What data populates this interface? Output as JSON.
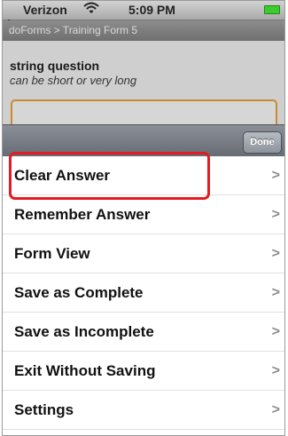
{
  "status": {
    "carrier": "Verizon",
    "wifi_icon": "wifi-icon",
    "time": "5:09 PM",
    "battery_icon": "battery-icon",
    "battery_color": "#3ccb2f"
  },
  "app": {
    "breadcrumb": "doForms > Training Form 5"
  },
  "question": {
    "title": "string question",
    "hint": "can be short or very long"
  },
  "sheet": {
    "done_label": "Done"
  },
  "menu": {
    "items": [
      {
        "label": "Clear Answer"
      },
      {
        "label": "Remember Answer"
      },
      {
        "label": "Form View"
      },
      {
        "label": "Save as Complete"
      },
      {
        "label": "Save as Incomplete"
      },
      {
        "label": "Exit Without Saving"
      },
      {
        "label": "Settings"
      }
    ],
    "chevron": ">"
  },
  "highlight_color": "#e31b23"
}
